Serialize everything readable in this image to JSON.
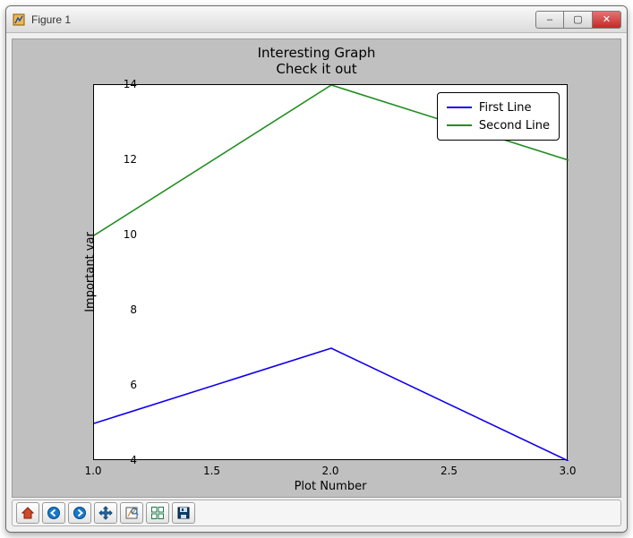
{
  "window": {
    "title": "Figure 1",
    "controls": {
      "min": "–",
      "max": "▢",
      "close": "✕"
    }
  },
  "chart_data": {
    "type": "line",
    "title": "Interesting Graph",
    "subtitle": "Check it out",
    "xlabel": "Plot Number",
    "ylabel": "Important var",
    "xlim": [
      1.0,
      3.0
    ],
    "ylim": [
      4,
      14
    ],
    "xticks": [
      "1.0",
      "1.5",
      "2.0",
      "2.5",
      "3.0"
    ],
    "yticks": [
      "4",
      "6",
      "8",
      "10",
      "12",
      "14"
    ],
    "x": [
      1,
      2,
      3
    ],
    "series": [
      {
        "name": "First Line",
        "values": [
          5,
          7,
          4
        ],
        "color": "#1100ee"
      },
      {
        "name": "Second Line",
        "values": [
          10,
          14,
          12
        ],
        "color": "#238e23"
      }
    ],
    "legend_position": "upper right",
    "grid": false
  },
  "toolbar": {
    "items": [
      {
        "name": "home-icon",
        "label": "Home"
      },
      {
        "name": "back-icon",
        "label": "Back"
      },
      {
        "name": "forward-icon",
        "label": "Forward"
      },
      {
        "name": "pan-icon",
        "label": "Pan"
      },
      {
        "name": "zoom-icon",
        "label": "Zoom"
      },
      {
        "name": "subplots-icon",
        "label": "Configure subplots"
      },
      {
        "name": "save-icon",
        "label": "Save"
      }
    ]
  }
}
